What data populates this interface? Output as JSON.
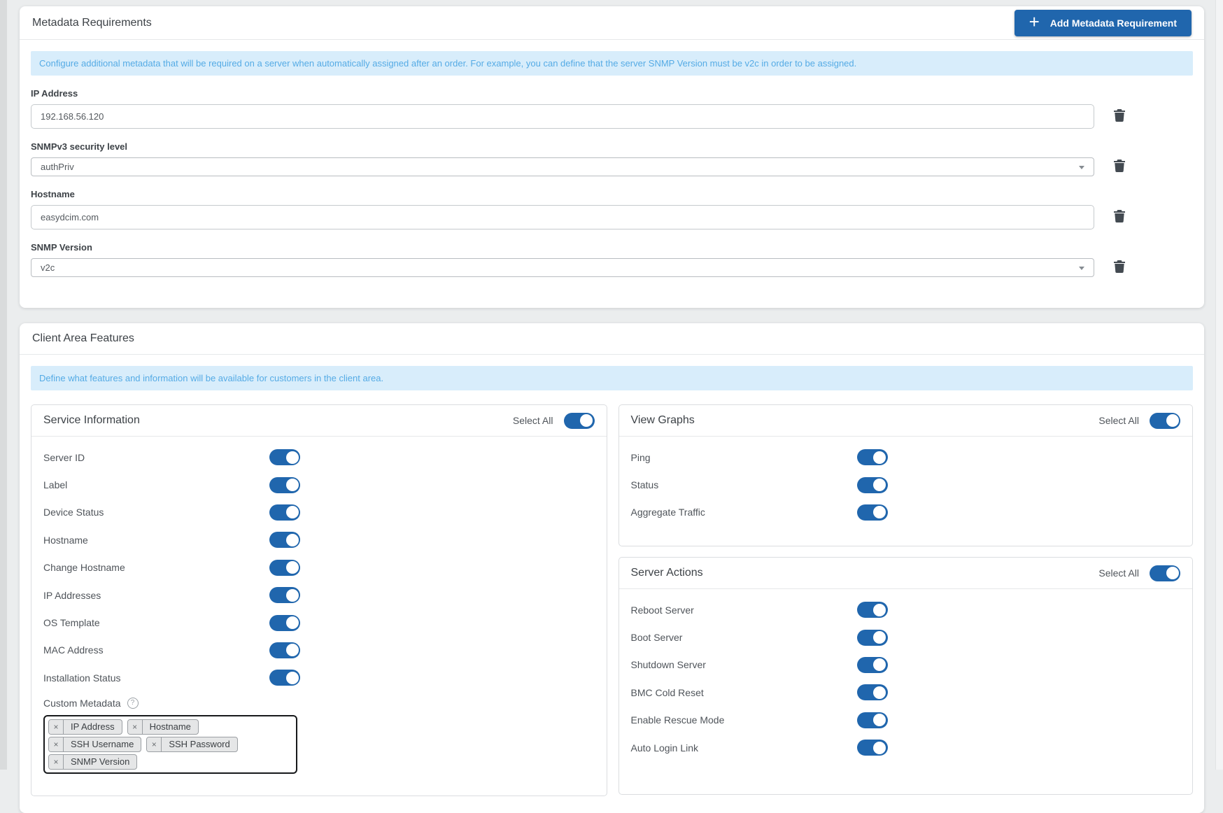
{
  "colors": {
    "accent_blue": "#2066ad",
    "banner_bg": "#d8edfb",
    "banner_text": "#55abe5",
    "card_bg": "#ffffff",
    "page_bg": "#ebedee"
  },
  "card1": {
    "title": "Metadata Requirements",
    "button": {
      "plus": "+",
      "label": "Add Metadata Requirement"
    },
    "info": "Configure additional metadata that will be required on a server when automatically assigned after an order. For example, you can define that the server SNMP Version must be v2c in order to be assigned.",
    "fields": [
      {
        "label": "IP Address",
        "value": "192.168.56.120",
        "control": "input"
      },
      {
        "label": "SNMPv3 security level",
        "value": "authPriv",
        "control": "select"
      },
      {
        "label": "Hostname",
        "value": "easydcim.com",
        "control": "input"
      },
      {
        "label": "SNMP Version",
        "value": "v2c",
        "control": "select"
      }
    ]
  },
  "card2": {
    "title": "Client Area Features",
    "info": "Define what features and information will be available for customers in the client area.",
    "select_all_label": "Select All",
    "service_information": {
      "title": "Service Information",
      "select_all_on": true,
      "rows": [
        {
          "label": "Server ID",
          "on": true
        },
        {
          "label": "Label",
          "on": true
        },
        {
          "label": "Device Status",
          "on": true
        },
        {
          "label": "Hostname",
          "on": true
        },
        {
          "label": "Change Hostname",
          "on": true
        },
        {
          "label": "IP Addresses",
          "on": true
        },
        {
          "label": "OS Template",
          "on": true
        },
        {
          "label": "MAC Address",
          "on": true
        },
        {
          "label": "Installation Status",
          "on": true
        }
      ],
      "custom_metadata": {
        "label": "Custom Metadata",
        "remove_glyph": "×",
        "tags": [
          "IP Address",
          "Hostname",
          "SSH Username",
          "SSH Password",
          "SNMP Version"
        ]
      }
    },
    "view_graphs": {
      "title": "View Graphs",
      "select_all_on": true,
      "rows": [
        {
          "label": "Ping",
          "on": true
        },
        {
          "label": "Status",
          "on": true
        },
        {
          "label": "Aggregate Traffic",
          "on": true
        }
      ]
    },
    "server_actions": {
      "title": "Server Actions",
      "select_all_on": true,
      "rows": [
        {
          "label": "Reboot Server",
          "on": true
        },
        {
          "label": "Boot Server",
          "on": true
        },
        {
          "label": "Shutdown Server",
          "on": true
        },
        {
          "label": "BMC Cold Reset",
          "on": true
        },
        {
          "label": "Enable Rescue Mode",
          "on": true
        },
        {
          "label": "Auto Login Link",
          "on": true
        }
      ]
    }
  }
}
